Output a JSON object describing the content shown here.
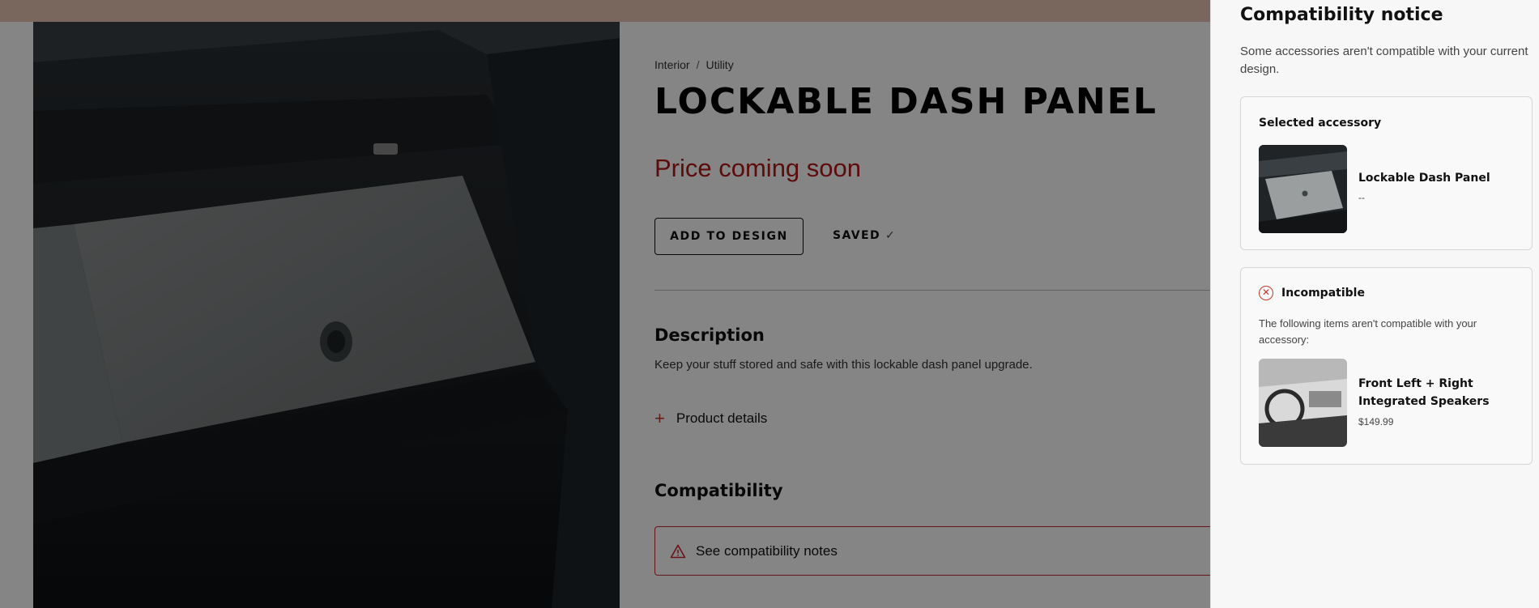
{
  "breadcrumb": {
    "items": [
      "Interior",
      "Utility"
    ],
    "separator": "/"
  },
  "product": {
    "title": "LOCKABLE DASH PANEL",
    "price": "Price coming soon",
    "add_button": "ADD TO DESIGN",
    "saved_label": "SAVED",
    "saved_icon": "checkmark-icon",
    "description_heading": "Description",
    "description_text": "Keep your stuff stored and safe with this lockable dash panel upgrade.",
    "details_label": "Product details",
    "compatibility_heading": "Compatibility",
    "compatibility_note": "See compatibility notes"
  },
  "panel": {
    "title": "Compatibility notice",
    "subtitle": "Some accessories aren't compatible with your current design.",
    "selected": {
      "label": "Selected accessory",
      "name": "Lockable Dash Panel",
      "price": "--"
    },
    "incompatible": {
      "label": "Incompatible",
      "text": "The following items aren't compatible with your accessory:",
      "item_name": "Front Left + Right Integrated Speakers",
      "item_price": "$149.99"
    }
  },
  "colors": {
    "accent_red": "#b31818",
    "top_strip": "#e9c6b4",
    "overlay": "rgba(0,0,0,0.48)"
  }
}
